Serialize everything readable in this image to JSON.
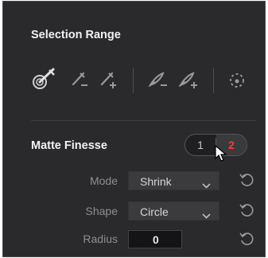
{
  "selection_range": {
    "title": "Selection Range",
    "tools": [
      {
        "icon": "picker-icon"
      },
      {
        "icon": "picker-subtract-icon"
      },
      {
        "icon": "picker-add-icon"
      },
      {
        "icon": "feather-subtract-icon"
      },
      {
        "icon": "feather-add-icon"
      },
      {
        "icon": "cursor-tool-icon"
      }
    ]
  },
  "matte_finesse": {
    "title": "Matte Finesse",
    "toggle": {
      "options": [
        "1",
        "2"
      ],
      "active": "2"
    },
    "mode": {
      "label": "Mode",
      "value": "Shrink"
    },
    "shape": {
      "label": "Shape",
      "value": "Circle"
    },
    "radius": {
      "label": "Radius",
      "value": "0"
    }
  },
  "colors": {
    "panel_bg": "#2a2a2c",
    "active_red": "#ff3a2a"
  }
}
